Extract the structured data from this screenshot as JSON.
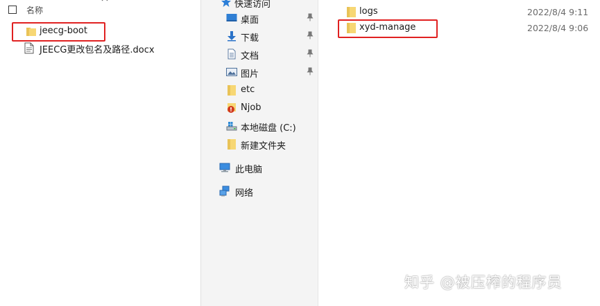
{
  "left_pane": {
    "column_header": "名称",
    "files": [
      {
        "name": "jeecg-boot",
        "type": "folder",
        "highlighted": true
      },
      {
        "name": "JEECG更改包名及路径.docx",
        "type": "document",
        "highlighted": false
      }
    ]
  },
  "nav_pane": {
    "quick_access": "快速访问",
    "items": [
      {
        "label": "桌面",
        "icon": "desktop-icon",
        "pinned": true
      },
      {
        "label": "下载",
        "icon": "download-icon",
        "pinned": true
      },
      {
        "label": "文档",
        "icon": "documents-icon",
        "pinned": true
      },
      {
        "label": "图片",
        "icon": "pictures-icon",
        "pinned": true
      },
      {
        "label": "etc",
        "icon": "folder-icon",
        "pinned": false
      },
      {
        "label": "Njob",
        "icon": "njob-icon",
        "pinned": false
      },
      {
        "label": "本地磁盘 (C:)",
        "icon": "drive-icon",
        "pinned": false
      },
      {
        "label": "新建文件夹",
        "icon": "folder-icon",
        "pinned": false
      }
    ],
    "this_pc": "此电脑",
    "network": "网络"
  },
  "right_pane": {
    "files": [
      {
        "name": "logs",
        "date": "2022/8/4 9:11",
        "highlighted": false
      },
      {
        "name": "xyd-manage",
        "date": "2022/8/4 9:06",
        "highlighted": true
      }
    ]
  },
  "watermark": "知乎 @被压榨的程序员",
  "colors": {
    "highlight": "#e02020",
    "folder": "#f7d774",
    "folder_dark": "#e7bf4d",
    "nav_bg": "#f4f4f4"
  }
}
